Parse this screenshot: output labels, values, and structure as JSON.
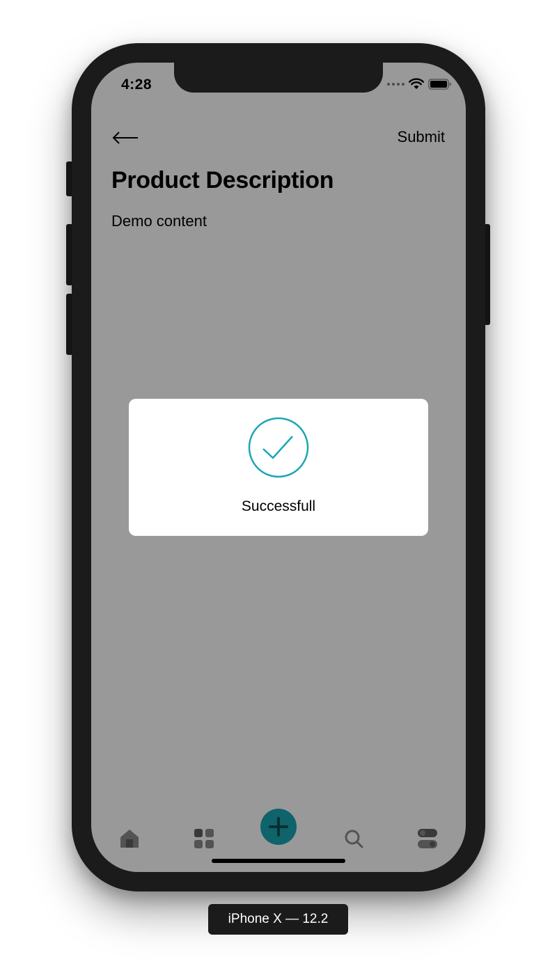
{
  "status_bar": {
    "time": "4:28"
  },
  "header": {
    "back_icon": "arrow-left-icon",
    "submit_label": "Submit"
  },
  "page": {
    "title": "Product Description",
    "body": "Demo content"
  },
  "alert": {
    "icon": "check-circle-icon",
    "message": "Successfull",
    "accent_color": "#1aa6b3"
  },
  "tab_bar": {
    "items": [
      {
        "icon": "home-icon"
      },
      {
        "icon": "grid-icon"
      },
      {
        "icon": "plus-icon"
      },
      {
        "icon": "search-icon"
      },
      {
        "icon": "toggle-icon"
      }
    ],
    "accent_color": "#1aa6b3"
  },
  "device_label": "iPhone X — 12.2"
}
